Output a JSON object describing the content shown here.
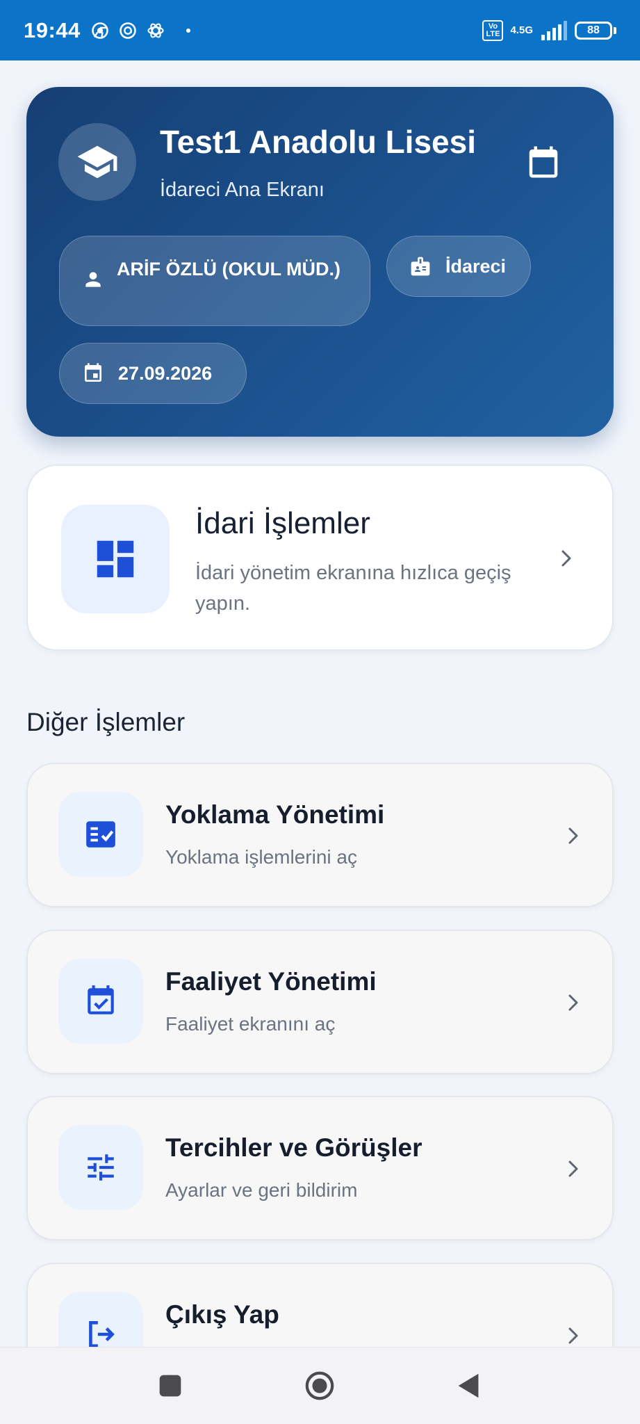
{
  "status_bar": {
    "time": "19:44",
    "network_label": "4.5G",
    "volte_label": "Vo LTE",
    "battery": "88"
  },
  "header": {
    "school_name": "Test1 Anadolu Lisesi",
    "subtitle": "İdareci Ana Ekranı",
    "user_name": "ARİF ÖZLÜ (OKUL MÜD.)",
    "role": "İdareci",
    "date": "27.09.2026"
  },
  "admin_card": {
    "title": "İdari İşlemler",
    "description": "İdari yönetim ekranına hızlıca geçiş yapın."
  },
  "section_title": "Diğer İşlemler",
  "menu_items": [
    {
      "title": "Yoklama Yönetimi",
      "description": "Yoklama işlemlerini aç",
      "icon": "checklist-icon"
    },
    {
      "title": "Faaliyet Yönetimi",
      "description": "Faaliyet ekranını aç",
      "icon": "event-available-icon"
    },
    {
      "title": "Tercihler ve Görüşler",
      "description": "Ayarlar ve geri bildirim",
      "icon": "tune-icon"
    },
    {
      "title": "Çıkış Yap",
      "description": "",
      "icon": "logout-icon"
    }
  ],
  "colors": {
    "status_bar": "#0b74c9",
    "header_start": "#163f74",
    "header_end": "#2161a2",
    "accent_icon": "#1d4fd8",
    "background": "#f1f5fb"
  }
}
